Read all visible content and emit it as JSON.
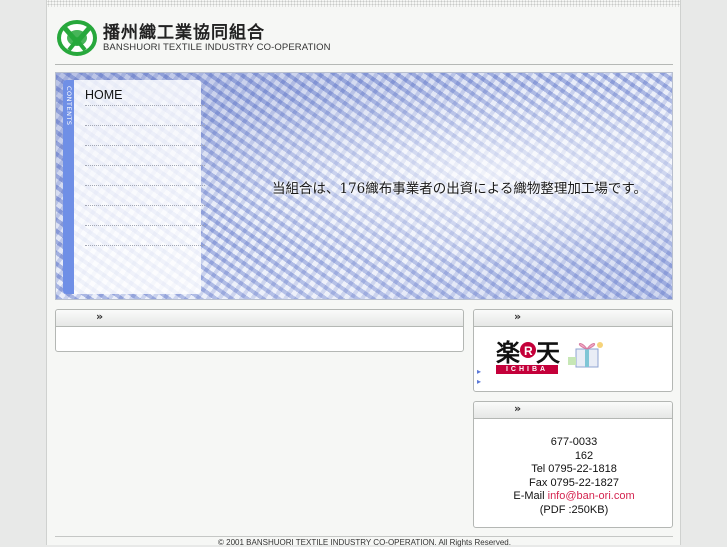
{
  "header": {
    "logo_jp": "播州織工業協同組合",
    "logo_en": "BANSHUORI TEXTILE INDUSTRY CO-OPERATION"
  },
  "hero": {
    "tagline": "当組合は、176織布事業者の出資による織物整理加工場です。"
  },
  "menu": {
    "tab_label": "CONTENTS",
    "items": [
      "HOME",
      "",
      "",
      "",
      "",
      "",
      "",
      ""
    ]
  },
  "news": {
    "arrow": "»"
  },
  "shop": {
    "arrow": "»",
    "rakuten_logo": "楽天",
    "rakuten_sub": "ICHIBA",
    "bullets": [
      "▸",
      "▸"
    ]
  },
  "contact": {
    "arrow": "»",
    "postal": "677-0033",
    "street_no": "162",
    "tel": "Tel 0795-22-1818",
    "fax": "Fax 0795-22-1827",
    "email_label": "E-Mail ",
    "email": "info@ban-ori.com",
    "pdf": "(PDF  :250KB)"
  },
  "footer": {
    "copyright": "© 2001 BANSHUORI TEXTILE INDUSTRY CO-OPERATION. All Rights Reserved."
  },
  "colors": {
    "accent": "#6f8fe6",
    "link": "#d4234f",
    "rakuten": "#c4003a",
    "logo_green": "#27a83c"
  }
}
